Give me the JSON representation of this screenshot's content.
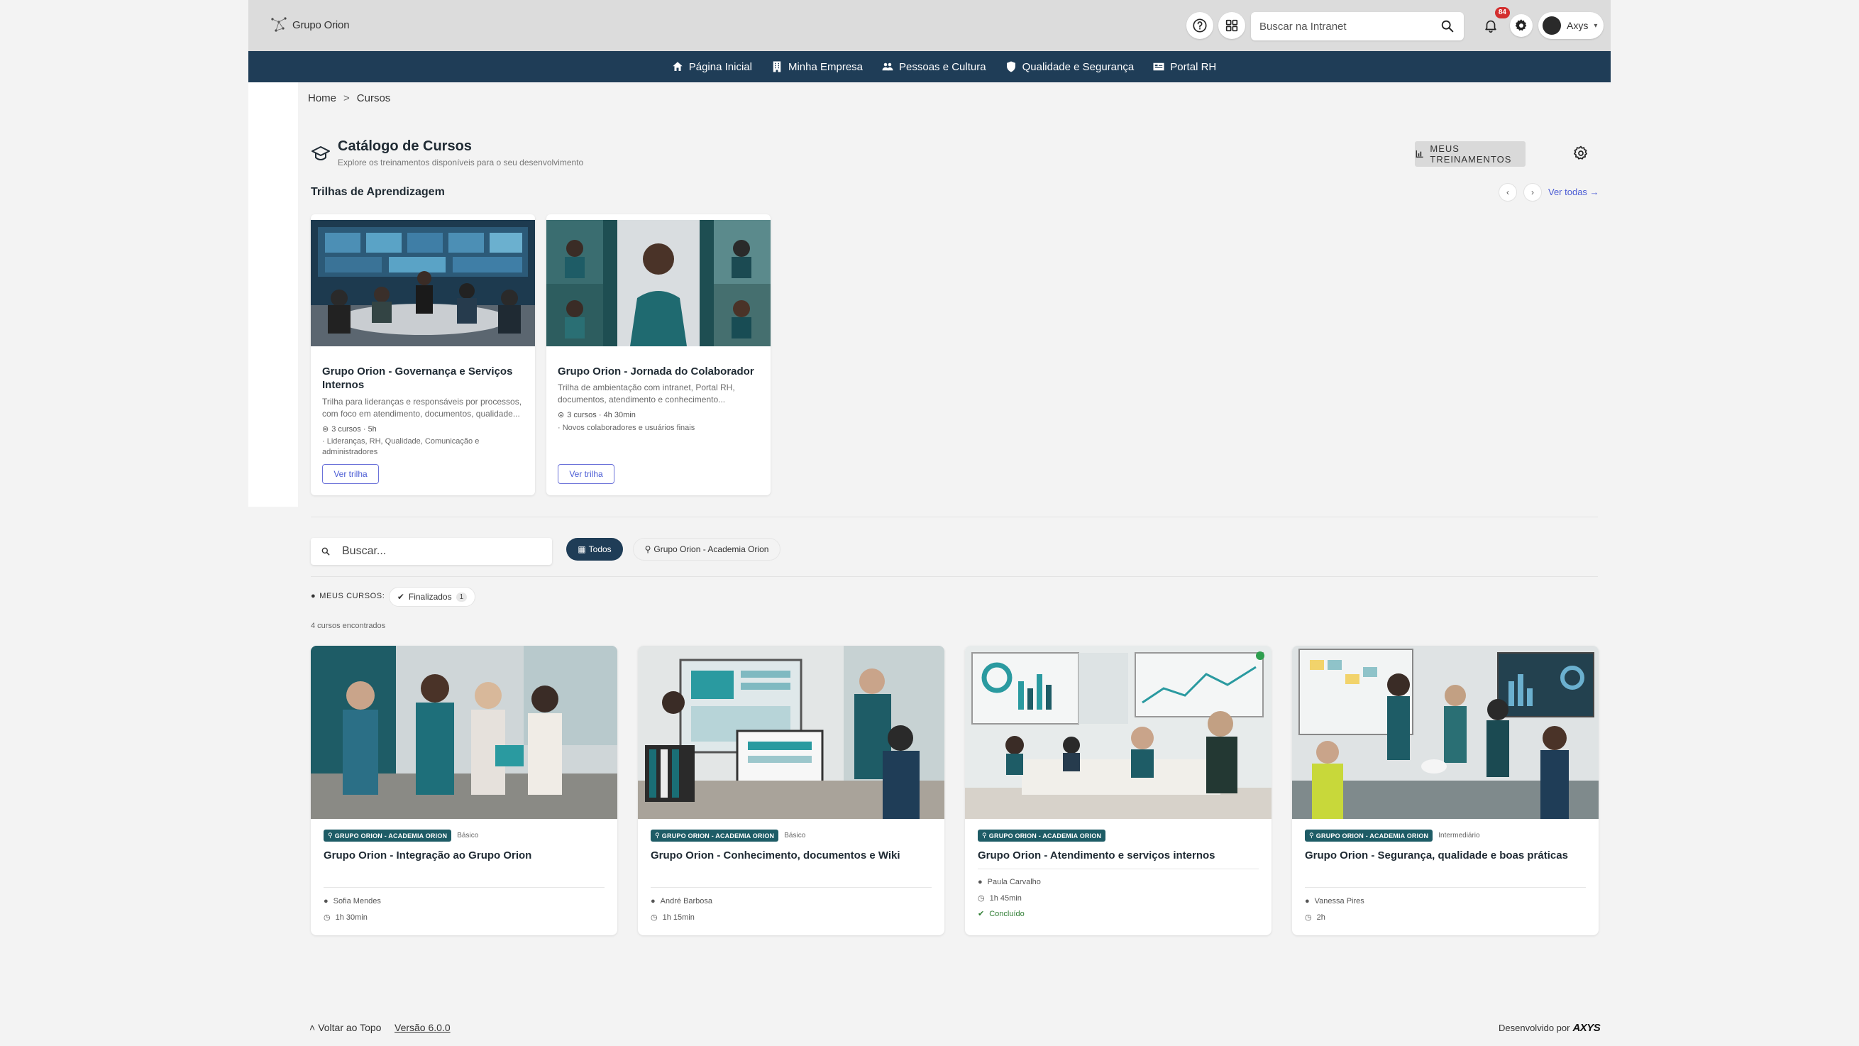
{
  "header": {
    "brand": "Grupo Orion",
    "search_placeholder": "Buscar na Intranet",
    "notifications_count": "84",
    "user_name": "Axys"
  },
  "nav": {
    "items": [
      {
        "label": "Página Inicial",
        "icon": "home-icon"
      },
      {
        "label": "Minha Empresa",
        "icon": "building-icon"
      },
      {
        "label": "Pessoas e Cultura",
        "icon": "people-icon"
      },
      {
        "label": "Qualidade e Segurança",
        "icon": "shield-icon"
      },
      {
        "label": "Portal RH",
        "icon": "id-card-icon"
      }
    ]
  },
  "breadcrumb": {
    "home": "Home",
    "separator": ">",
    "current": "Cursos"
  },
  "catalog": {
    "title": "Catálogo de Cursos",
    "subtitle": "Explore os treinamentos disponíveis para o seu desenvolvimento",
    "my_trainings_label": "MEUS TREINAMENTOS"
  },
  "trails": {
    "title": "Trilhas de Aprendizagem",
    "prev": "‹",
    "next": "›",
    "see_all": "Ver todas →",
    "items": [
      {
        "name": "Grupo Orion - Governança e Serviços Internos",
        "description": "Trilha para lideranças e responsáveis por processos, com foco em atendimento, documentos, qualidade...",
        "meta": "3 cursos · 5h",
        "audience": "· Lideranças, RH, Qualidade, Comunicação e administradores",
        "button": "Ver trilha"
      },
      {
        "name": "Grupo Orion - Jornada do Colaborador",
        "description": "Trilha de ambientação com intranet, Portal RH, documentos, atendimento e conhecimento...",
        "meta": "3 cursos · 4h 30min",
        "audience": "· Novos colaboradores e usuários finais",
        "button": "Ver trilha"
      }
    ]
  },
  "filters": {
    "search_placeholder": "Buscar...",
    "chip_all": "Todos",
    "chip_academy": "Grupo Orion - Academia Orion",
    "my_courses_label": "MEUS CURSOS:",
    "finished_label": "Finalizados",
    "finished_count": "1",
    "found_text": "4 cursos encontrados"
  },
  "courses": [
    {
      "tag": "GRUPO ORION - ACADEMIA ORION",
      "level": "Básico",
      "title": "Grupo Orion - Integração ao Grupo Orion",
      "author": "Sofia Mendes",
      "duration": "1h 30min",
      "status": ""
    },
    {
      "tag": "GRUPO ORION - ACADEMIA ORION",
      "level": "Básico",
      "title": "Grupo Orion - Conhecimento, documentos e Wiki",
      "author": "André Barbosa",
      "duration": "1h 15min",
      "status": ""
    },
    {
      "tag": "GRUPO ORION - ACADEMIA ORION",
      "level": "",
      "title": "Grupo Orion - Atendimento e serviços internos",
      "author": "Paula Carvalho",
      "duration": "1h 45min",
      "status": "Concluído"
    },
    {
      "tag": "GRUPO ORION - ACADEMIA ORION",
      "level": "Intermediário",
      "title": "Grupo Orion - Segurança, qualidade e boas práticas",
      "author": "Vanessa Pires",
      "duration": "2h",
      "status": ""
    }
  ],
  "footer": {
    "back_to_top": "Voltar ao Topo",
    "version": "Versão 6.0.0",
    "developed_by": "Desenvolvido por",
    "developer": "AXYS"
  },
  "colors": {
    "nav_bg": "#1f3d57",
    "accent": "#4a5bd4",
    "tag_bg": "#1e5c66",
    "done": "#2e7d32",
    "badge": "#d32f2f"
  }
}
